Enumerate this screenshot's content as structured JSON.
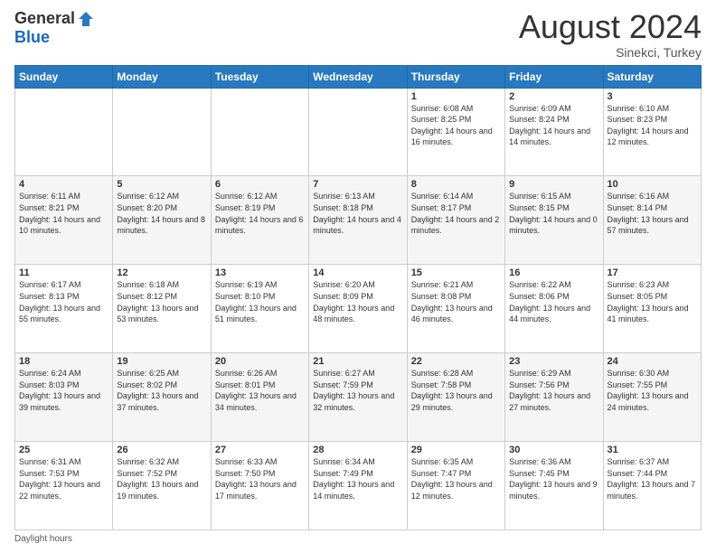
{
  "logo": {
    "general": "General",
    "blue": "Blue"
  },
  "title": {
    "month_year": "August 2024",
    "location": "Sinekci, Turkey"
  },
  "days_of_week": [
    "Sunday",
    "Monday",
    "Tuesday",
    "Wednesday",
    "Thursday",
    "Friday",
    "Saturday"
  ],
  "weeks": [
    [
      {
        "day": "",
        "info": ""
      },
      {
        "day": "",
        "info": ""
      },
      {
        "day": "",
        "info": ""
      },
      {
        "day": "",
        "info": ""
      },
      {
        "day": "1",
        "info": "Sunrise: 6:08 AM\nSunset: 8:25 PM\nDaylight: 14 hours and 16 minutes."
      },
      {
        "day": "2",
        "info": "Sunrise: 6:09 AM\nSunset: 8:24 PM\nDaylight: 14 hours and 14 minutes."
      },
      {
        "day": "3",
        "info": "Sunrise: 6:10 AM\nSunset: 8:23 PM\nDaylight: 14 hours and 12 minutes."
      }
    ],
    [
      {
        "day": "4",
        "info": "Sunrise: 6:11 AM\nSunset: 8:21 PM\nDaylight: 14 hours and 10 minutes."
      },
      {
        "day": "5",
        "info": "Sunrise: 6:12 AM\nSunset: 8:20 PM\nDaylight: 14 hours and 8 minutes."
      },
      {
        "day": "6",
        "info": "Sunrise: 6:12 AM\nSunset: 8:19 PM\nDaylight: 14 hours and 6 minutes."
      },
      {
        "day": "7",
        "info": "Sunrise: 6:13 AM\nSunset: 8:18 PM\nDaylight: 14 hours and 4 minutes."
      },
      {
        "day": "8",
        "info": "Sunrise: 6:14 AM\nSunset: 8:17 PM\nDaylight: 14 hours and 2 minutes."
      },
      {
        "day": "9",
        "info": "Sunrise: 6:15 AM\nSunset: 8:15 PM\nDaylight: 14 hours and 0 minutes."
      },
      {
        "day": "10",
        "info": "Sunrise: 6:16 AM\nSunset: 8:14 PM\nDaylight: 13 hours and 57 minutes."
      }
    ],
    [
      {
        "day": "11",
        "info": "Sunrise: 6:17 AM\nSunset: 8:13 PM\nDaylight: 13 hours and 55 minutes."
      },
      {
        "day": "12",
        "info": "Sunrise: 6:18 AM\nSunset: 8:12 PM\nDaylight: 13 hours and 53 minutes."
      },
      {
        "day": "13",
        "info": "Sunrise: 6:19 AM\nSunset: 8:10 PM\nDaylight: 13 hours and 51 minutes."
      },
      {
        "day": "14",
        "info": "Sunrise: 6:20 AM\nSunset: 8:09 PM\nDaylight: 13 hours and 48 minutes."
      },
      {
        "day": "15",
        "info": "Sunrise: 6:21 AM\nSunset: 8:08 PM\nDaylight: 13 hours and 46 minutes."
      },
      {
        "day": "16",
        "info": "Sunrise: 6:22 AM\nSunset: 8:06 PM\nDaylight: 13 hours and 44 minutes."
      },
      {
        "day": "17",
        "info": "Sunrise: 6:23 AM\nSunset: 8:05 PM\nDaylight: 13 hours and 41 minutes."
      }
    ],
    [
      {
        "day": "18",
        "info": "Sunrise: 6:24 AM\nSunset: 8:03 PM\nDaylight: 13 hours and 39 minutes."
      },
      {
        "day": "19",
        "info": "Sunrise: 6:25 AM\nSunset: 8:02 PM\nDaylight: 13 hours and 37 minutes."
      },
      {
        "day": "20",
        "info": "Sunrise: 6:26 AM\nSunset: 8:01 PM\nDaylight: 13 hours and 34 minutes."
      },
      {
        "day": "21",
        "info": "Sunrise: 6:27 AM\nSunset: 7:59 PM\nDaylight: 13 hours and 32 minutes."
      },
      {
        "day": "22",
        "info": "Sunrise: 6:28 AM\nSunset: 7:58 PM\nDaylight: 13 hours and 29 minutes."
      },
      {
        "day": "23",
        "info": "Sunrise: 6:29 AM\nSunset: 7:56 PM\nDaylight: 13 hours and 27 minutes."
      },
      {
        "day": "24",
        "info": "Sunrise: 6:30 AM\nSunset: 7:55 PM\nDaylight: 13 hours and 24 minutes."
      }
    ],
    [
      {
        "day": "25",
        "info": "Sunrise: 6:31 AM\nSunset: 7:53 PM\nDaylight: 13 hours and 22 minutes."
      },
      {
        "day": "26",
        "info": "Sunrise: 6:32 AM\nSunset: 7:52 PM\nDaylight: 13 hours and 19 minutes."
      },
      {
        "day": "27",
        "info": "Sunrise: 6:33 AM\nSunset: 7:50 PM\nDaylight: 13 hours and 17 minutes."
      },
      {
        "day": "28",
        "info": "Sunrise: 6:34 AM\nSunset: 7:49 PM\nDaylight: 13 hours and 14 minutes."
      },
      {
        "day": "29",
        "info": "Sunrise: 6:35 AM\nSunset: 7:47 PM\nDaylight: 13 hours and 12 minutes."
      },
      {
        "day": "30",
        "info": "Sunrise: 6:36 AM\nSunset: 7:45 PM\nDaylight: 13 hours and 9 minutes."
      },
      {
        "day": "31",
        "info": "Sunrise: 6:37 AM\nSunset: 7:44 PM\nDaylight: 13 hours and 7 minutes."
      }
    ]
  ],
  "footer": {
    "label": "Daylight hours"
  }
}
